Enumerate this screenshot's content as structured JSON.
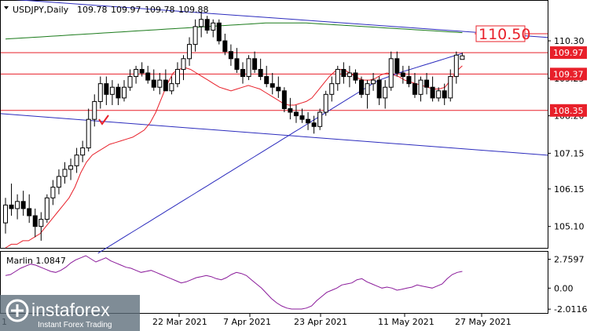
{
  "chart_data": [
    {
      "type": "candlestick",
      "header": {
        "symbol_timeframe": "USDJPY,Daily",
        "open": "109.78",
        "high": "109.97",
        "low": "109.78",
        "close": "109.88"
      },
      "y_ticks": [
        "110.30",
        "109.25",
        "108.20",
        "107.15",
        "106.15",
        "105.10"
      ],
      "x_ticks": [
        "22 Mar 2021",
        "7 Apr 2021",
        "23 Apr 2021",
        "11 May 2021",
        "27 May 2021"
      ],
      "x_tick_prefix": "1",
      "ylim": [
        104.5,
        111.4
      ],
      "levels": [
        {
          "label": "110.50",
          "value": 110.5,
          "color": "#e8202a",
          "style": "target"
        },
        {
          "label": "109.97",
          "value": 109.97,
          "color": "#e8202a",
          "style": "badge"
        },
        {
          "label": "109.37",
          "value": 109.37,
          "color": "#e8202a",
          "style": "badge"
        },
        {
          "label": "108.35",
          "value": 108.35,
          "color": "#e8202a",
          "style": "badge"
        }
      ],
      "trendlines": [
        {
          "from_bar": 0,
          "from_value": 108.25,
          "to_bar": 91,
          "to_value": 107.1,
          "color": "#2b2bbd"
        },
        {
          "from_bar": 30,
          "from_value": 111.12,
          "to_bar": 91,
          "to_value": 110.4,
          "color": "#2b2bbd"
        }
      ],
      "candles": [
        [
          105.2,
          105.9,
          104.9,
          105.7
        ],
        [
          105.7,
          106.3,
          105.4,
          105.6
        ],
        [
          105.6,
          106.0,
          105.3,
          105.8
        ],
        [
          105.8,
          106.1,
          105.4,
          105.6
        ],
        [
          105.6,
          106.0,
          105.2,
          105.4
        ],
        [
          105.4,
          105.6,
          104.8,
          105.1
        ],
        [
          105.1,
          105.5,
          104.7,
          105.3
        ],
        [
          105.3,
          106.0,
          105.2,
          105.9
        ],
        [
          105.9,
          106.4,
          105.7,
          106.2
        ],
        [
          106.2,
          106.7,
          106.0,
          106.5
        ],
        [
          106.5,
          106.9,
          106.3,
          106.7
        ],
        [
          106.7,
          107.0,
          106.4,
          106.8
        ],
        [
          106.8,
          107.3,
          106.6,
          107.1
        ],
        [
          107.1,
          107.5,
          106.9,
          107.3
        ],
        [
          107.3,
          108.4,
          107.2,
          108.1
        ],
        [
          108.1,
          108.8,
          107.9,
          108.6
        ],
        [
          108.6,
          109.3,
          108.4,
          109.1
        ],
        [
          109.1,
          109.3,
          108.5,
          108.8
        ],
        [
          108.8,
          109.2,
          108.5,
          109.0
        ],
        [
          109.0,
          109.1,
          108.5,
          108.7
        ],
        [
          108.7,
          109.2,
          108.6,
          109.0
        ],
        [
          109.0,
          109.5,
          108.9,
          109.3
        ],
        [
          109.3,
          109.6,
          109.1,
          109.5
        ],
        [
          109.5,
          109.7,
          109.3,
          109.4
        ],
        [
          109.4,
          109.6,
          109.1,
          109.2
        ],
        [
          109.2,
          109.5,
          108.9,
          109.0
        ],
        [
          109.0,
          109.4,
          108.8,
          109.2
        ],
        [
          109.2,
          109.5,
          109.0,
          108.9
        ],
        [
          108.9,
          109.3,
          108.8,
          109.1
        ],
        [
          109.1,
          109.7,
          109.0,
          109.5
        ],
        [
          109.5,
          109.9,
          109.2,
          109.8
        ],
        [
          109.8,
          110.4,
          109.6,
          110.2
        ],
        [
          110.2,
          110.9,
          110.0,
          110.7
        ],
        [
          110.7,
          111.1,
          110.4,
          110.9
        ],
        [
          110.9,
          111.0,
          110.5,
          110.6
        ],
        [
          110.6,
          110.9,
          110.4,
          110.8
        ],
        [
          110.8,
          110.9,
          110.2,
          110.3
        ],
        [
          110.3,
          110.5,
          109.9,
          110.0
        ],
        [
          110.0,
          110.2,
          109.6,
          109.8
        ],
        [
          109.8,
          110.1,
          109.4,
          109.5
        ],
        [
          109.5,
          109.7,
          109.1,
          109.3
        ],
        [
          109.3,
          109.9,
          109.2,
          109.8
        ],
        [
          109.8,
          110.0,
          109.4,
          109.5
        ],
        [
          109.5,
          109.8,
          109.2,
          109.3
        ],
        [
          109.3,
          109.6,
          109.0,
          109.1
        ],
        [
          109.1,
          109.4,
          108.8,
          109.0
        ],
        [
          109.0,
          109.3,
          108.7,
          108.9
        ],
        [
          108.9,
          109.0,
          108.3,
          108.4
        ],
        [
          108.4,
          108.7,
          108.1,
          108.3
        ],
        [
          108.3,
          108.5,
          108.0,
          108.2
        ],
        [
          108.2,
          108.4,
          108.0,
          108.1
        ],
        [
          108.1,
          108.3,
          107.8,
          108.0
        ],
        [
          108.0,
          108.2,
          107.7,
          107.9
        ],
        [
          107.9,
          108.4,
          107.8,
          108.3
        ],
        [
          108.3,
          108.9,
          108.2,
          108.8
        ],
        [
          108.8,
          109.3,
          108.6,
          109.1
        ],
        [
          109.1,
          109.6,
          108.9,
          109.5
        ],
        [
          109.5,
          109.7,
          109.1,
          109.3
        ],
        [
          109.3,
          109.6,
          109.0,
          109.4
        ],
        [
          109.4,
          109.5,
          109.1,
          109.2
        ],
        [
          109.2,
          109.3,
          108.7,
          108.8
        ],
        [
          108.8,
          109.2,
          108.4,
          109.1
        ],
        [
          109.1,
          109.4,
          108.9,
          109.2
        ],
        [
          109.2,
          109.3,
          108.5,
          108.7
        ],
        [
          108.7,
          109.2,
          108.4,
          109.0
        ],
        [
          109.0,
          110.0,
          108.9,
          109.8
        ],
        [
          109.8,
          110.0,
          109.3,
          109.4
        ],
        [
          109.4,
          109.6,
          109.1,
          109.3
        ],
        [
          109.3,
          109.6,
          109.0,
          109.1
        ],
        [
          109.1,
          109.4,
          108.7,
          108.8
        ],
        [
          108.8,
          109.3,
          108.6,
          109.2
        ],
        [
          109.2,
          109.4,
          108.8,
          109.0
        ],
        [
          109.0,
          109.3,
          108.6,
          108.7
        ],
        [
          108.7,
          109.0,
          108.6,
          108.9
        ],
        [
          108.9,
          109.1,
          108.5,
          108.7
        ],
        [
          108.7,
          109.5,
          108.6,
          109.3
        ],
        [
          109.3,
          110.0,
          109.1,
          109.9
        ],
        [
          109.78,
          109.97,
          109.78,
          109.88
        ]
      ],
      "ma_series": [
        {
          "color": "#e8202a",
          "values": [
            104.5,
            104.6,
            104.6,
            104.7,
            104.7,
            104.8,
            104.9,
            105.1,
            105.3,
            105.5,
            105.7,
            105.9,
            106.2,
            106.6,
            106.9,
            107.1,
            107.2,
            107.3,
            107.4,
            107.45,
            107.5,
            107.55,
            107.6,
            107.7,
            107.8,
            108.0,
            108.3,
            108.7,
            109.1,
            109.4,
            109.5,
            109.55,
            109.5,
            109.4,
            109.3,
            109.2,
            109.1,
            109.0,
            108.95,
            108.9,
            108.95,
            109.0,
            109.05,
            109.0,
            108.95,
            108.85,
            108.75,
            108.65,
            108.55,
            108.5,
            108.5,
            108.55,
            108.6,
            108.7,
            108.9,
            109.1,
            109.3,
            109.45,
            109.5,
            109.45,
            109.35,
            109.25,
            109.2,
            109.2,
            109.25,
            109.35,
            109.4,
            109.35,
            109.3,
            109.2,
            109.15,
            109.1,
            109.05,
            109.0,
            108.95,
            108.95,
            109.0,
            109.2,
            109.45,
            109.6
          ]
        },
        {
          "color": "#2b2bbd",
          "values": [
            null,
            null,
            null,
            null,
            null,
            null,
            null,
            null,
            null,
            null,
            null,
            null,
            null,
            null,
            null,
            null,
            104.35,
            104.45,
            104.55,
            104.65,
            104.75,
            104.85,
            104.95,
            105.05,
            105.15,
            105.25,
            105.35,
            105.45,
            105.55,
            105.65,
            105.75,
            105.85,
            105.95,
            106.05,
            106.15,
            106.25,
            106.35,
            106.45,
            106.55,
            106.65,
            106.75,
            106.85,
            106.95,
            107.05,
            107.15,
            107.25,
            107.35,
            107.45,
            107.55,
            107.65,
            107.75,
            107.85,
            107.95,
            108.05,
            108.15,
            108.25,
            108.35,
            108.45,
            108.55,
            108.65,
            108.75,
            108.85,
            108.95,
            109.05,
            109.15,
            109.22,
            109.28,
            109.34,
            109.4,
            109.45,
            109.5,
            109.55,
            109.6,
            109.65,
            109.7,
            109.75,
            109.8,
            109.85,
            109.9,
            109.95
          ]
        },
        {
          "color": "#1a7a1a",
          "values": [
            110.35,
            110.36,
            110.37,
            110.38,
            110.39,
            110.4,
            110.41,
            110.42,
            110.43,
            110.44,
            110.45,
            110.46,
            110.47,
            110.48,
            110.49,
            110.5,
            110.51,
            110.52,
            110.53,
            110.54,
            110.55,
            110.56,
            110.57,
            110.58,
            110.59,
            110.6,
            110.61,
            110.62,
            110.63,
            110.64,
            110.65,
            110.66,
            110.67,
            110.68,
            110.69,
            110.7,
            110.71,
            110.72,
            110.73,
            110.74,
            110.75,
            110.76,
            110.77,
            110.78,
            110.79,
            110.8,
            110.8,
            110.8,
            110.8,
            110.8,
            110.8,
            110.8,
            110.8,
            110.79,
            110.78,
            110.77,
            110.76,
            110.75,
            110.74,
            110.73,
            110.72,
            110.71,
            110.7,
            110.69,
            110.68,
            110.67,
            110.66,
            110.65,
            110.64,
            110.63,
            110.62,
            110.61,
            110.6,
            110.59,
            110.58,
            110.57,
            110.56,
            110.55,
            110.54,
            110.53
          ]
        }
      ]
    },
    {
      "type": "line",
      "indicator_label": "Marlin 1.0847",
      "y_ticks": [
        "2.7597",
        "0.00",
        "-2.0116"
      ],
      "ylim": [
        -2.3,
        3.4
      ],
      "color": "#8a1a9a",
      "values": [
        1.2,
        1.3,
        1.6,
        1.9,
        2.1,
        2.3,
        2.2,
        2.0,
        1.8,
        1.6,
        1.5,
        1.7,
        2.0,
        2.4,
        2.7,
        2.9,
        3.1,
        2.8,
        2.5,
        2.7,
        2.9,
        2.6,
        2.4,
        2.2,
        2.0,
        1.9,
        1.7,
        1.5,
        1.6,
        1.7,
        1.5,
        1.3,
        1.1,
        0.9,
        0.7,
        0.5,
        0.6,
        0.8,
        1.0,
        1.1,
        1.2,
        1.1,
        0.9,
        0.8,
        1.0,
        1.3,
        1.5,
        1.4,
        1.2,
        0.8,
        0.4,
        0.0,
        -0.5,
        -1.0,
        -1.4,
        -1.7,
        -1.9,
        -2.0,
        -2.0,
        -2.0,
        -1.9,
        -1.7,
        -1.2,
        -0.8,
        -0.4,
        -0.2,
        0.0,
        0.3,
        0.4,
        0.5,
        0.8,
        0.9,
        0.6,
        0.4,
        0.2,
        0.0,
        0.1,
        0.0,
        -0.2,
        -0.1,
        0.0,
        0.1,
        0.3,
        0.2,
        0.1,
        0.0,
        0.2,
        0.4,
        0.9,
        1.3,
        1.5,
        1.6
      ]
    }
  ],
  "watermark": {
    "brand": "instaforex",
    "tagline": "Instant Forex Trading"
  }
}
